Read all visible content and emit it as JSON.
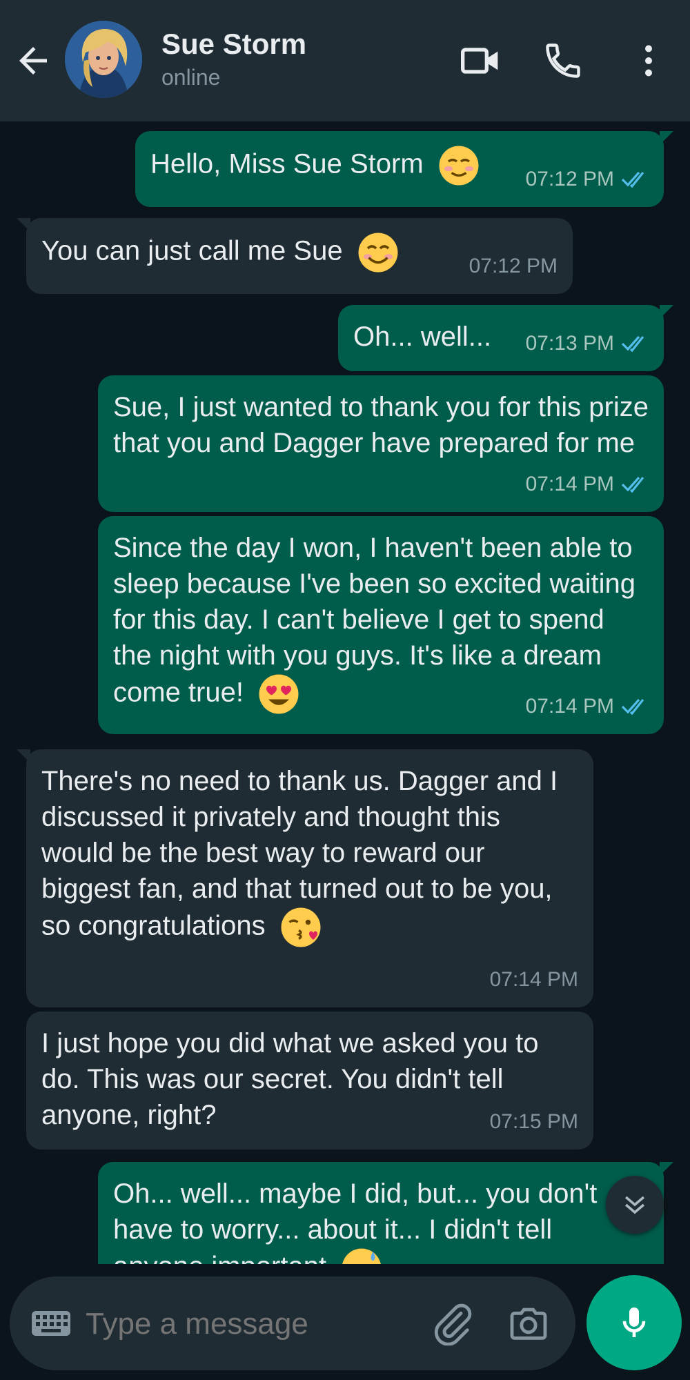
{
  "header": {
    "contact_name": "Sue Storm",
    "status": "online"
  },
  "messages": [
    {
      "dir": "out",
      "text": "Hello, Miss Sue Storm",
      "emoji": "relieved-smile",
      "time": "07:12 PM",
      "ticks": "read"
    },
    {
      "dir": "in",
      "text": "You can just call me Sue",
      "emoji": "smiling-face",
      "time": "07:12 PM"
    },
    {
      "dir": "out",
      "text": "Oh... well...",
      "time": "07:13 PM",
      "ticks": "read"
    },
    {
      "dir": "out",
      "text": "Sue, I just wanted to thank you for this prize that you and Dagger have prepared for me",
      "time": "07:14 PM",
      "ticks": "read"
    },
    {
      "dir": "out",
      "text": "Since the day I won, I haven't been able to sleep because I've been so excited waiting for this day. I can't believe I get to spend the night with you guys. It's like a dream come true!",
      "emoji": "heart-eyes",
      "time": "07:14 PM",
      "ticks": "read"
    },
    {
      "dir": "in",
      "text": "There's no need to thank us. Dagger and I discussed it privately and thought this would be the best way to reward our biggest fan, and that turned out to be you, so congratulations",
      "emoji": "kiss-face",
      "time": "07:14 PM"
    },
    {
      "dir": "in",
      "text": "I just hope you did what we asked you to do. This was our secret. You didn't tell anyone, right?",
      "time": "07:15 PM"
    },
    {
      "dir": "out",
      "text": "Oh... well... maybe I did, but... you don't have to worry... about it... I didn't tell anyone important",
      "emoji": "sweat-smile",
      "time": "",
      "ticks": ""
    }
  ],
  "composer": {
    "placeholder": "Type a message"
  },
  "icons": {
    "back": "back-arrow-icon",
    "video": "video-call-icon",
    "call": "phone-icon",
    "menu": "more-vert-icon",
    "keyboard": "keyboard-icon",
    "attach": "paperclip-icon",
    "camera": "camera-icon",
    "mic": "mic-icon",
    "scroll": "double-chevron-down-icon"
  },
  "colors": {
    "header_bg": "#1f2c34",
    "chat_bg": "#0b141a",
    "outgoing": "#005c4b",
    "incoming": "#202c33",
    "accent": "#00a884",
    "read_tick": "#53bdeb"
  }
}
